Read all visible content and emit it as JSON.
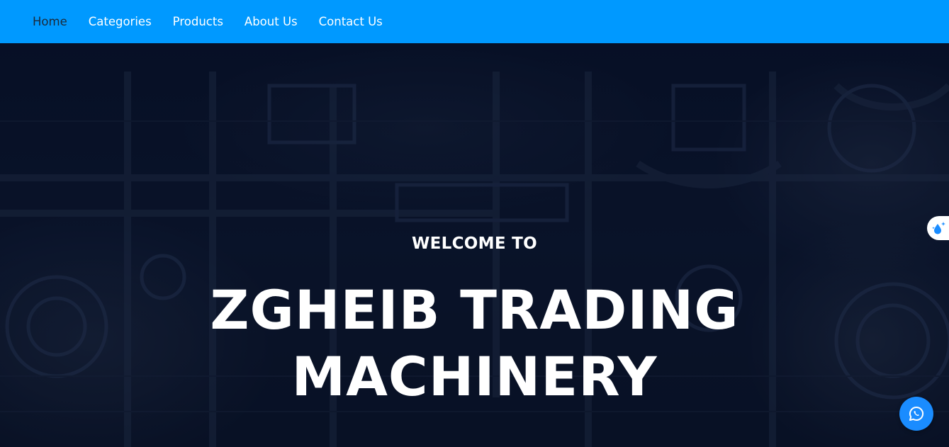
{
  "nav": {
    "items": [
      {
        "label": "Home",
        "active": true
      },
      {
        "label": "Categories",
        "active": false
      },
      {
        "label": "Products",
        "active": false
      },
      {
        "label": "About Us",
        "active": false
      },
      {
        "label": "Contact Us",
        "active": false
      }
    ]
  },
  "hero": {
    "welcome": "WELCOME TO",
    "title_line1": "ZGHEIB TRADING",
    "title_line2": "MACHINERY"
  },
  "widgets": {
    "side_icon": "water-drop-sparkle-icon",
    "chat_icon": "whatsapp-icon"
  },
  "colors": {
    "nav_bg": "#0099ff",
    "active_link": "#1b2a3a",
    "hero_bg": "#0a1428",
    "chat_button": "#1a8cff"
  }
}
